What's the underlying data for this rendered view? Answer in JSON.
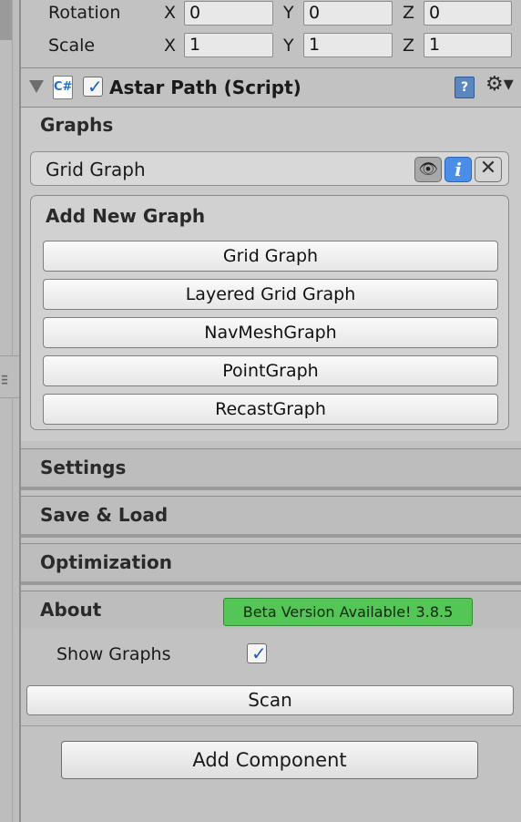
{
  "transform": {
    "rotation": {
      "label": "Rotation",
      "x_axis": "X",
      "x": "0",
      "y_axis": "Y",
      "y": "0",
      "z_axis": "Z",
      "z": "0"
    },
    "scale": {
      "label": "Scale",
      "x_axis": "X",
      "x": "1",
      "y_axis": "Y",
      "y": "1",
      "z_axis": "Z",
      "z": "1"
    }
  },
  "component": {
    "title": "Astar Path (Script)",
    "script_icon": "csharp-script-icon",
    "enabled": true,
    "help_icon": "book-help-icon",
    "gear_icon": "gear-icon",
    "gear_glyph": "⚙▾",
    "help_glyph": "?",
    "script_glyph": "C#"
  },
  "graphs": {
    "section_label": "Graphs",
    "items": [
      {
        "name": "Grid Graph",
        "eye_glyph": "👁",
        "info_glyph": "i",
        "close_glyph": "✕"
      }
    ],
    "add_new": {
      "title": "Add New Graph",
      "buttons": [
        "Grid Graph",
        "Layered Grid Graph",
        "NavMeshGraph",
        "PointGraph",
        "RecastGraph"
      ]
    }
  },
  "sections": {
    "settings": "Settings",
    "save_load": "Save & Load",
    "optimization": "Optimization",
    "about": "About"
  },
  "beta_badge": "Beta Version Available! 3.8.5",
  "colors": {
    "beta_badge": "#54c655",
    "info_button": "#4a8ee8",
    "panel_bg": "#c2c2c2"
  },
  "show_graphs": {
    "label": "Show Graphs",
    "checked": true
  },
  "scan_button": "Scan",
  "add_component_button": "Add Component"
}
